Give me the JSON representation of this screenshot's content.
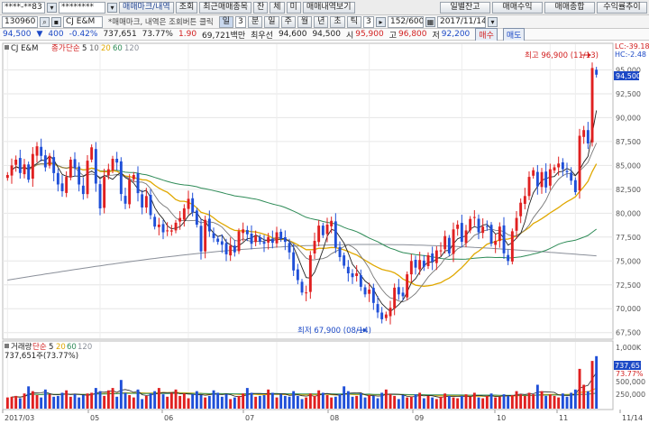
{
  "toolbar": {
    "account": "****-**83",
    "password": "********",
    "tabs": [
      "매매마크/내역",
      "조회",
      "최근매매종목"
    ],
    "menu": [
      "잔",
      "체",
      "미",
      "매매내역보기"
    ],
    "right_buttons": [
      "일별잔고",
      "매매수익",
      "매매종합",
      "수익률추이"
    ]
  },
  "row2": {
    "code": "130960",
    "name": "CJ E&M",
    "note": "*매매마크, 내역은 조회버튼 클릭",
    "mode": "일",
    "period_value": "3",
    "periods": [
      "분",
      "일",
      "주",
      "월",
      "년",
      "초",
      "틱"
    ],
    "count_value": "3",
    "range": "152/600",
    "date": "2017/11/14"
  },
  "info": {
    "price": "94,500",
    "change": "400",
    "change_rate": "-0.42%",
    "volume": "737,651",
    "vol_ratio": "73.77%",
    "turnover": "1.90",
    "amount": "69,721백만",
    "prev_label": "최우선",
    "ask": "94,600",
    "bid": "94,500",
    "high_label": "시",
    "open": "95,900",
    "hi_label": "고",
    "high": "96,800",
    "lo_label": "저",
    "low": "92,200",
    "sell_btn": "매수",
    "buy_btn": "매도"
  },
  "chart_data": {
    "type": "candlestick",
    "title": "CJ E&M",
    "ma_legend_price": [
      "종가",
      "단순",
      "5",
      "10",
      "20",
      "60",
      "120"
    ],
    "ma_legend_volume": [
      "거래량",
      "단순",
      "5",
      "20",
      "60",
      "120"
    ],
    "volume_label": "737,651주(73.77%)",
    "ylim": [
      67000,
      97500
    ],
    "yticks": [
      "95,000",
      "92,500",
      "90,000",
      "87,500",
      "85,000",
      "82,500",
      "80,000",
      "77,500",
      "75,000",
      "72,500",
      "70,000",
      "67,500"
    ],
    "xticks": [
      "2017/03",
      "05",
      "06",
      "07",
      "08",
      "09",
      "10",
      "11",
      "11/14"
    ],
    "current_price_label": "94,500",
    "current_vol_label": "737,651",
    "vol_yticks": [
      "1,000K",
      "737,651",
      "73.77%",
      "500,000",
      "250,000"
    ],
    "top_right": [
      "LC:-39.18",
      "HC:-2.48"
    ],
    "annotations": {
      "high": "최고 96,900 (11/13)",
      "low": "최저 67,900 (08/14)"
    },
    "closes": [
      84000,
      85000,
      85600,
      84200,
      85100,
      83500,
      86200,
      87000,
      86000,
      84800,
      86000,
      84200,
      83000,
      82300,
      83800,
      85600,
      84700,
      83000,
      82000,
      85500,
      86900,
      83100,
      80500,
      83800,
      84600,
      85700,
      85300,
      82000,
      81000,
      83500,
      84000,
      82100,
      80600,
      81800,
      79800,
      78600,
      78800,
      78000,
      78200,
      78200,
      79000,
      79500,
      80500,
      81500,
      80100,
      78800,
      76000,
      79300,
      78100,
      77400,
      77000,
      76700,
      75700,
      76600,
      75900,
      78100,
      78300,
      77800,
      76800,
      77600,
      77000,
      76800,
      77500,
      76900,
      78000,
      77300,
      77000,
      75900,
      74000,
      73000,
      71700,
      71700,
      75600,
      77100,
      78700,
      77700,
      78800,
      79200,
      76400,
      75400,
      74500,
      73700,
      73300,
      73700,
      72300,
      71500,
      72000,
      70600,
      69600,
      68900,
      69400,
      70100,
      72200,
      71500,
      71300,
      73600,
      75000,
      74300,
      75100,
      74400,
      75600,
      74900,
      76100,
      76100,
      77600,
      75800,
      78300,
      78800,
      77000,
      78200,
      79400,
      79600,
      78000,
      78600,
      78600,
      76800,
      77100,
      78600,
      75800,
      75000,
      78100,
      79500,
      81100,
      81800,
      83800,
      84500,
      82800,
      84300,
      82700,
      84600,
      84800,
      85200,
      84600,
      84300,
      83400,
      82200,
      88100,
      88700,
      87300,
      95200,
      94500
    ],
    "volumes": [
      70,
      75,
      80,
      65,
      95,
      140,
      110,
      85,
      70,
      120,
      90,
      75,
      80,
      100,
      115,
      75,
      90,
      70,
      85,
      95,
      100,
      130,
      110,
      80,
      115,
      130,
      75,
      180,
      100,
      85,
      70,
      120,
      60,
      80,
      95,
      110,
      130,
      90,
      75,
      100,
      120,
      80,
      95,
      65,
      90,
      110,
      85,
      70,
      80,
      115,
      100,
      75,
      90,
      60,
      70,
      80,
      95,
      130,
      100,
      75,
      80,
      85,
      120,
      100,
      70,
      90,
      80,
      75,
      110,
      80,
      60,
      70,
      95,
      80,
      115,
      100,
      85,
      70,
      75,
      90,
      140,
      110,
      75,
      80,
      95,
      70,
      85,
      80,
      65,
      100,
      120,
      90,
      80,
      60,
      85,
      70,
      75,
      90,
      100,
      65,
      80,
      70,
      60,
      75,
      95,
      80,
      70,
      65,
      80,
      90,
      75,
      100,
      70,
      65,
      80,
      95,
      70,
      75,
      90,
      80,
      85,
      110,
      90,
      80,
      100,
      90,
      150,
      110,
      80,
      90,
      80,
      70,
      95,
      75,
      100,
      120,
      250,
      150,
      110,
      300,
      330
    ]
  },
  "colors": {
    "up": "#e02020",
    "down": "#1f4fd8",
    "ma5": "#222222",
    "ma20": "#e0a800",
    "ma60": "#2e8b57",
    "ma120": "#8a8f99"
  }
}
